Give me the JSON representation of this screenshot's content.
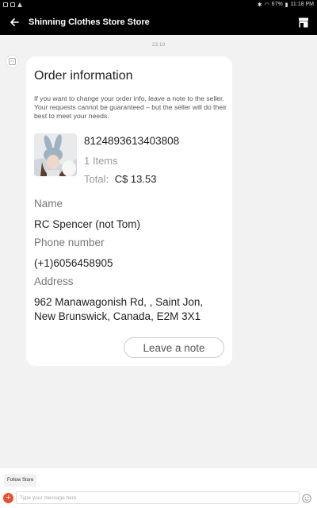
{
  "status_bar": {
    "battery": "67%",
    "time": "11:18 PM"
  },
  "header": {
    "title": "Shinning Clothes Store Store"
  },
  "chat": {
    "timestamp": "23:10"
  },
  "order_card": {
    "title": "Order information",
    "description": "If you want to change your order info, leave a note to the seller. Your requests cannot be guaranteed – but the seller will do their best to meet your needs.",
    "order_id": "8124893613403808",
    "items": "1 Items",
    "total_label": "Total:",
    "total_value": "C$ 13.53",
    "name_label": "Name",
    "name_value": "RC Spencer (not Tom)",
    "phone_label": "Phone number",
    "phone_value": "(+1)6056458905",
    "address_label": "Address",
    "address_line1": "962 Manawagonish Rd, , Saint Jon,",
    "address_line2": "New Brunswick, Canada, E2M 3X1",
    "leave_note": "Leave a note"
  },
  "footer": {
    "follow_store": "Follow Store",
    "message_placeholder": "Type your message here"
  }
}
